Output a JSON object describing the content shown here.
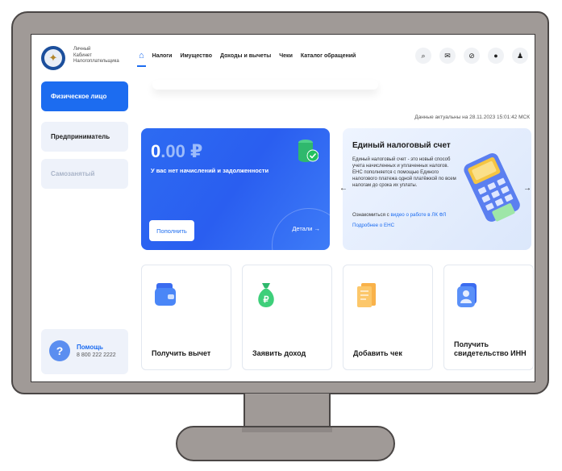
{
  "brand": {
    "line1": "Личный",
    "line2": "Кабинет",
    "line3": "Налогоплательщика"
  },
  "nav": {
    "home_icon": "home-icon",
    "items": [
      "Налоги",
      "Имущество",
      "Доходы и вычеты",
      "Чеки",
      "Каталог обращений"
    ]
  },
  "top_icons": [
    "search-icon",
    "mail-icon",
    "eye-off-icon",
    "lightbulb-icon",
    "user-icon"
  ],
  "sidebar": {
    "items": [
      {
        "label": "Физическое лицо",
        "state": "active"
      },
      {
        "label": "Предприниматель",
        "state": "normal"
      },
      {
        "label": "Самозанятый",
        "state": "disabled"
      }
    ],
    "help": {
      "title": "Помощь",
      "phone": "8 800 222 2222"
    }
  },
  "data_actual": "Данные актуальны на 28.11.2023 15:01:42 МСК",
  "balance": {
    "amount_int": "0",
    "amount_dec": ".00",
    "currency": "₽",
    "text": "У вас нет начислений и задолженности",
    "topup_button": "Пополнить",
    "details_link": "Детали →"
  },
  "ens": {
    "title": "Единый налоговый счет",
    "body": "Единый налоговый счет - это новый способ учета начисленных и уплаченных налогов. ЕНС пополняется с помощью Единого налогового платежа одной платёжкой по всем налогам до срока их уплаты.",
    "video_prefix": "Ознакомиться с ",
    "video_link": "видео о работе в ЛК ФЛ",
    "more_link": "Подробнее о ЕНС"
  },
  "tiles": [
    {
      "label": "Получить вычет",
      "icon": "wallet-icon"
    },
    {
      "label": "Заявить доход",
      "icon": "ruble-bag-icon"
    },
    {
      "label": "Добавить чек",
      "icon": "receipt-icon"
    },
    {
      "label": "Получить свидетельство ИНН",
      "icon": "id-card-icon"
    }
  ],
  "colors": {
    "accent": "#1c6cf0",
    "frame": "#a09a97",
    "panel": "#eef2fa"
  }
}
